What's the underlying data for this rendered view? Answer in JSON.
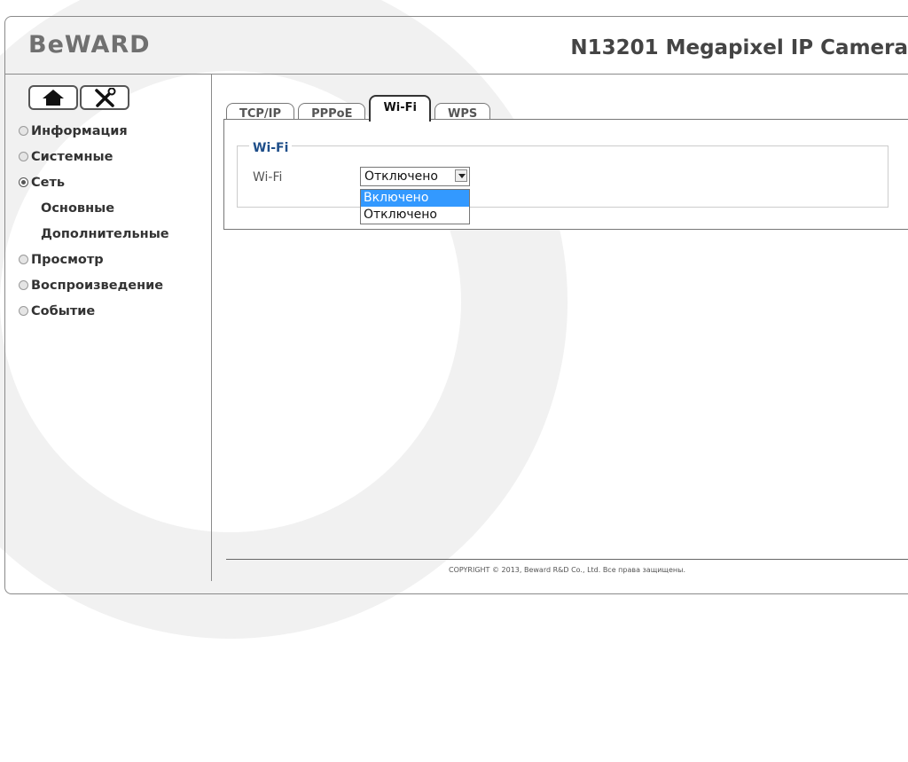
{
  "header": {
    "logo": "BeWARD",
    "title": "N13201 Megapixel IP Camera"
  },
  "toolbar": {
    "home_icon": "home-icon",
    "settings_icon": "tools-icon"
  },
  "sidebar": {
    "items": [
      {
        "label": "Информация",
        "active": false
      },
      {
        "label": "Системные",
        "active": false
      },
      {
        "label": "Сеть",
        "active": true
      },
      {
        "label": "Основные",
        "sub": true
      },
      {
        "label": "Дополнительные",
        "sub": true
      },
      {
        "label": "Просмотр",
        "active": false
      },
      {
        "label": "Воспроизведение",
        "active": false
      },
      {
        "label": "Событие",
        "active": false
      }
    ]
  },
  "tabs": [
    {
      "label": "TCP/IP",
      "active": false
    },
    {
      "label": "PPPoE",
      "active": false
    },
    {
      "label": "Wi-Fi",
      "active": true
    },
    {
      "label": "WPS",
      "active": false
    }
  ],
  "section": {
    "legend": "Wi-Fi",
    "field_label": "Wi-Fi",
    "select_value": "Отключено",
    "options": [
      "Включено",
      "Отключено"
    ],
    "highlighted_option": "Включено"
  },
  "footer": {
    "copyright": "COPYRIGHT © 2013, Beward R&D Co., Ltd. Все права защищены."
  },
  "colors": {
    "legend": "#1f4f8a",
    "highlight": "#3399ff"
  }
}
